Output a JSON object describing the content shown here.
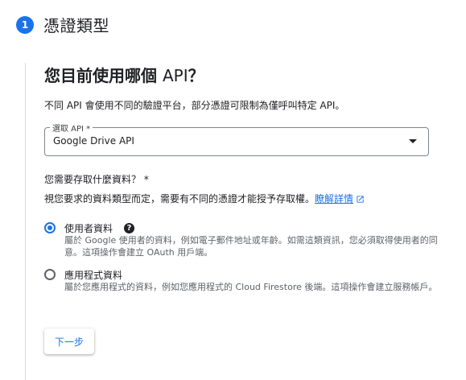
{
  "step": {
    "number": "1",
    "title": "憑證類型"
  },
  "question1": {
    "title_prefix": "您目前使用哪個 ",
    "title_bold": "API",
    "title_suffix": "？",
    "description": "不同 API 會使用不同的驗證平台，部分憑證可限制為僅呼叫特定 API。"
  },
  "select": {
    "label": "選取 API *",
    "value": "Google Drive API"
  },
  "question2": {
    "title": "您需要存取什麼資料？ *",
    "description": "視您要求的資料類型而定，需要有不同的憑證才能授予存取權。",
    "learn_more": "瞭解詳情"
  },
  "options": [
    {
      "label": "使用者資料",
      "checked": true,
      "help": "?",
      "description": "屬於 Google 使用者的資料，例如電子郵件地址或年齡。如需這類資訊，您必須取得使用者的同意。這項操作會建立 OAuth 用戶端。"
    },
    {
      "label": "應用程式資料",
      "checked": false,
      "description": "屬於您應用程式的資料，例如您應用程式的 Cloud Firestore 後端。這項操作會建立服務帳戶。"
    }
  ],
  "next_button": "下一步",
  "colors": {
    "accent": "#1a73e8",
    "text": "#202124",
    "secondary": "#5f6368",
    "border": "#dadce0"
  }
}
